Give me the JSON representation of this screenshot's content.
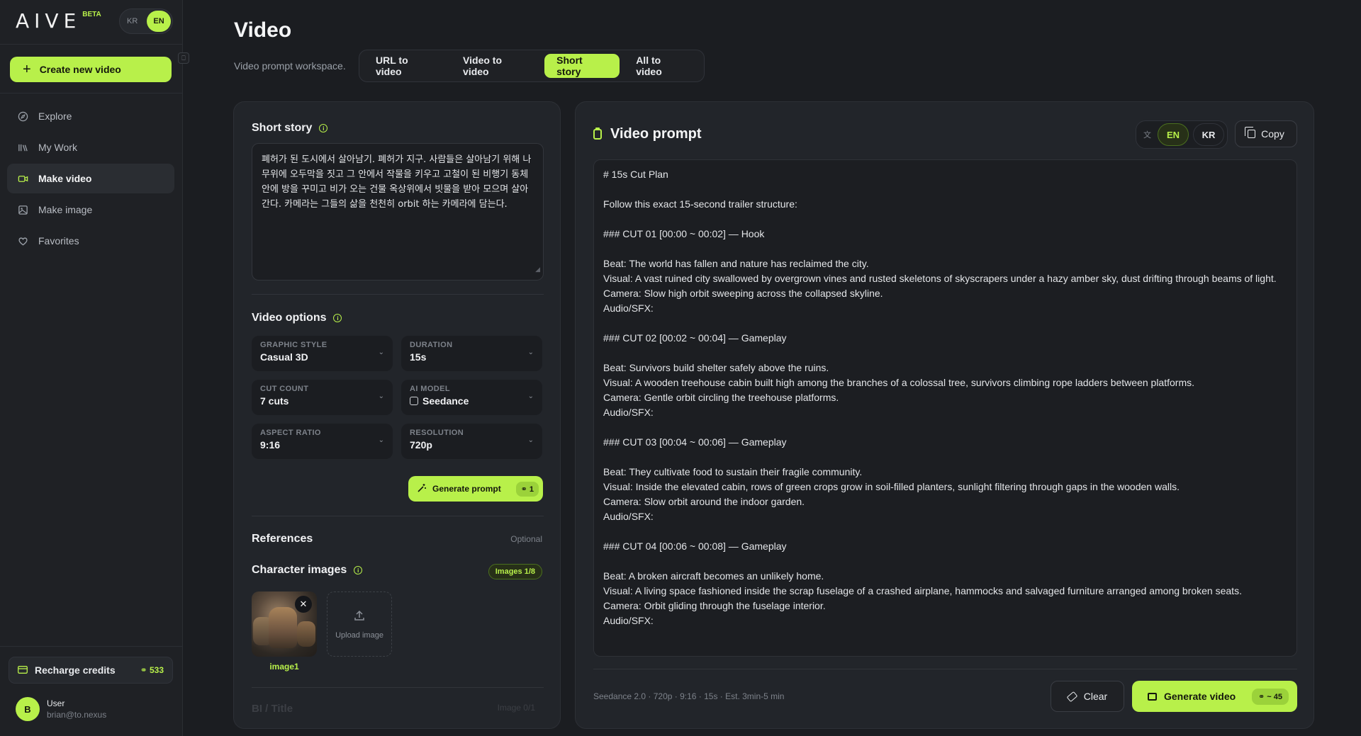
{
  "app": {
    "logo": "AIVE",
    "beta": "BETA"
  },
  "lang_switch": {
    "kr": "KR",
    "en": "EN"
  },
  "sidebar": {
    "create_label": "Create new video",
    "items": [
      {
        "label": "Explore",
        "icon": "compass-icon"
      },
      {
        "label": "My Work",
        "icon": "library-icon"
      },
      {
        "label": "Make video",
        "icon": "video-camera-icon",
        "active": true
      },
      {
        "label": "Make image",
        "icon": "image-icon"
      },
      {
        "label": "Favorites",
        "icon": "heart-icon"
      }
    ],
    "recharge_label": "Recharge credits",
    "credits": "533",
    "user": {
      "initial": "B",
      "name": "User",
      "email": "brian@to.nexus"
    }
  },
  "header": {
    "title": "Video",
    "subtitle": "Video prompt workspace.",
    "tabs": [
      {
        "label": "URL to video"
      },
      {
        "label": "Video to video"
      },
      {
        "label": "Short story",
        "active": true
      },
      {
        "label": "All to video"
      }
    ]
  },
  "left": {
    "story_title": "Short story",
    "story_text": "폐허가 된 도시에서 살아남기. 폐허가 지구. 사람들은 살아남기 위해 나무위에 오두막을 짓고 그 안에서 작물을 키우고 고철이 된 비행기 동체 안에 방을 꾸미고 비가 오는 건물 옥상위에서 빗물을 받아 모으며 살아간다. 카메라는 그들의 삶을 천천히 orbit 하는 카메라에 담는다.",
    "options_title": "Video options",
    "options": {
      "graphic_style": {
        "label": "GRAPHIC STYLE",
        "value": "Casual 3D"
      },
      "duration": {
        "label": "DURATION",
        "value": "15s"
      },
      "cut_count": {
        "label": "CUT COUNT",
        "value": "7 cuts"
      },
      "ai_model": {
        "label": "AI MODEL",
        "value": "Seedance"
      },
      "aspect_ratio": {
        "label": "ASPECT RATIO",
        "value": "9:16"
      },
      "resolution": {
        "label": "RESOLUTION",
        "value": "720p"
      }
    },
    "generate_prompt": {
      "label": "Generate prompt",
      "cost": "1"
    },
    "references_title": "References",
    "optional": "Optional",
    "character_title": "Character images",
    "images_badge": "Images 1/8",
    "image_caption": "image1",
    "upload_label": "Upload image",
    "next_section": "BI / Title",
    "next_section_count": "Image 0/1"
  },
  "right": {
    "title": "Video prompt",
    "lang": {
      "en": "EN",
      "kr": "KR"
    },
    "copy_label": "Copy",
    "prompt_lines": [
      "# 15s Cut Plan",
      "",
      "Follow this exact 15-second trailer structure:",
      "",
      "### CUT 01 [00:00 ~ 00:02] — Hook",
      "",
      "Beat: The world has fallen and nature has reclaimed the city.",
      "Visual: A vast ruined city swallowed by overgrown vines and rusted skeletons of skyscrapers under a hazy amber sky, dust drifting through beams of light.",
      "Camera: Slow high orbit sweeping across the collapsed skyline.",
      "Audio/SFX:",
      "",
      "### CUT 02 [00:02 ~ 00:04] — Gameplay",
      "",
      "Beat: Survivors build shelter safely above the ruins.",
      "Visual: A wooden treehouse cabin built high among the branches of a colossal tree, survivors climbing rope ladders between platforms.",
      "Camera: Gentle orbit circling the treehouse platforms.",
      "Audio/SFX:",
      "",
      "### CUT 03 [00:04 ~ 00:06] — Gameplay",
      "",
      "Beat: They cultivate food to sustain their fragile community.",
      "Visual: Inside the elevated cabin, rows of green crops grow in soil-filled planters, sunlight filtering through gaps in the wooden walls.",
      "Camera: Slow orbit around the indoor garden.",
      "Audio/SFX:",
      "",
      "### CUT 04 [00:06 ~ 00:08] — Gameplay",
      "",
      "Beat: A broken aircraft becomes an unlikely home.",
      "Visual: A living space fashioned inside the scrap fuselage of a crashed airplane, hammocks and salvaged furniture arranged among broken seats.",
      "Camera: Orbit gliding through the fuselage interior.",
      "Audio/SFX:"
    ],
    "meta": "Seedance 2.0 · 720p · 9:16 · 15s · Est. 3min-5 min",
    "clear_label": "Clear",
    "generate_video": {
      "label": "Generate video",
      "cost": "~ 45"
    }
  }
}
